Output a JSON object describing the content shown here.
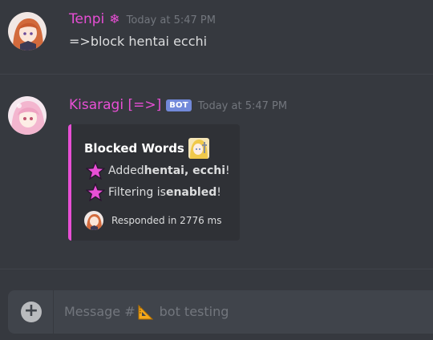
{
  "messages": [
    {
      "username": "Tenpi",
      "username_suffix": "❄",
      "timestamp": "Today at 5:47 PM",
      "content": "=>block hentai ecchi",
      "avatar_icon": "anime-avatar-icon"
    },
    {
      "username": "Kisaragi [=>]",
      "badge": "BOT",
      "timestamp": "Today at 5:47 PM",
      "avatar_icon": "anime-avatar-icon",
      "embed": {
        "accent": "#e84fd5",
        "title": "Blocked Words",
        "lines": [
          {
            "prefix": "Added ",
            "bold": "hentai, ecchi",
            "suffix": "!"
          },
          {
            "prefix": "Filtering is ",
            "bold": "enabled",
            "suffix": "!"
          }
        ],
        "footer": "Responded in 2776 ms"
      }
    }
  ],
  "composer": {
    "placeholder_prefix": "Message #",
    "placeholder_channel": "bot testing",
    "add_icon": "plus-circle-icon"
  },
  "colors": {
    "background": "#36393f",
    "username": "#e84fd5",
    "bot_badge": "#7289da",
    "timestamp": "#72767d",
    "composer": "#40444b"
  }
}
